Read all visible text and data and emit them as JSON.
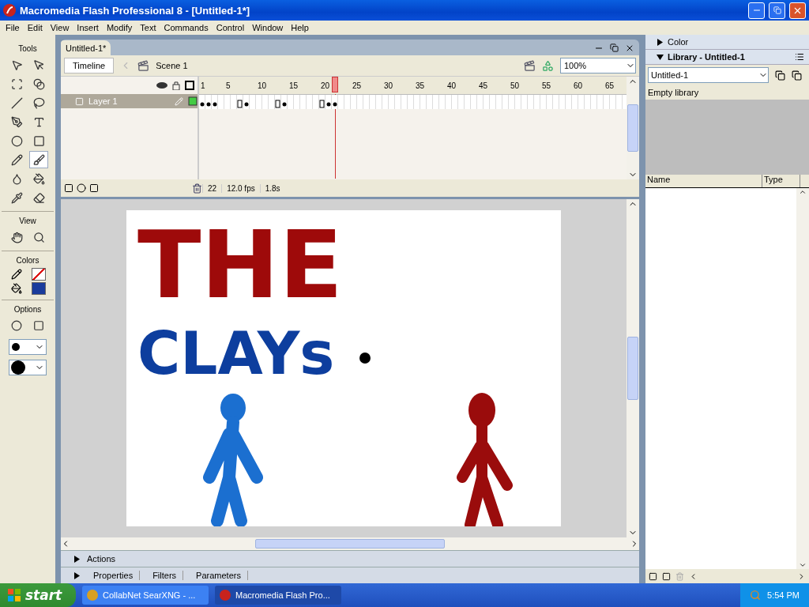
{
  "window": {
    "title": "Macromedia Flash Professional 8 - [Untitled-1*]"
  },
  "menu": [
    "File",
    "Edit",
    "View",
    "Insert",
    "Modify",
    "Text",
    "Commands",
    "Control",
    "Window",
    "Help"
  ],
  "toolbox": {
    "title": "Tools",
    "view_title": "View",
    "colors_title": "Colors",
    "options_title": "Options",
    "tools": [
      {
        "selected": false
      },
      {
        "selected": false
      },
      {
        "selected": false
      },
      {
        "selected": false
      },
      {
        "selected": false
      },
      {
        "selected": false
      },
      {
        "selected": false
      },
      {
        "selected": false
      },
      {
        "selected": false
      },
      {
        "selected": false
      },
      {
        "selected": false
      },
      {
        "selected": true
      },
      {
        "selected": false
      },
      {
        "selected": false
      },
      {
        "selected": false
      },
      {
        "selected": false
      }
    ]
  },
  "document": {
    "tab": "Untitled-1*",
    "timeline_button": "Timeline",
    "scene": "Scene 1",
    "zoom": "100%"
  },
  "timeline": {
    "layers": [
      {
        "name": "Layer 1",
        "selected": true
      }
    ],
    "frame_labels": [
      "1",
      "5",
      "10",
      "15",
      "20",
      "25",
      "30",
      "35",
      "40",
      "45",
      "50",
      "55",
      "60",
      "65"
    ],
    "current_frame": "22",
    "fps": "12.0 fps",
    "time": "1.8s"
  },
  "stage": {
    "words": [
      {
        "text": "THE",
        "color": "#9e0a0a"
      },
      {
        "text": "CLAYs",
        "color": "#0d3e9e"
      }
    ]
  },
  "bottom_panels": {
    "actions": "Actions",
    "tabs": [
      "Properties",
      "Filters",
      "Parameters"
    ]
  },
  "right_panel": {
    "color_panel": {
      "title": "Color",
      "expanded": false
    },
    "library_panel": {
      "title": "Library - Untitled-1",
      "expanded": true,
      "document": "Untitled-1",
      "status": "Empty library",
      "columns": [
        "Name",
        "Type"
      ]
    }
  },
  "taskbar": {
    "start": "start",
    "tasks": [
      {
        "label": "CollabNet SearXNG - ...",
        "selected": false
      },
      {
        "label": "Macromedia Flash Pro...",
        "selected": true
      }
    ],
    "clock": "5:54 PM"
  }
}
